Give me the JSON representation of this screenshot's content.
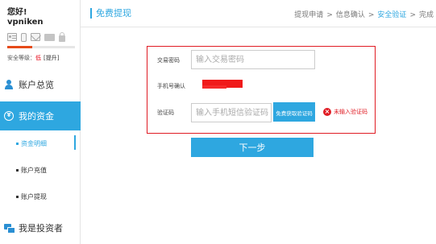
{
  "sidebar": {
    "greeting": "您好!",
    "username": "vpniken",
    "verify_icons": [
      "id-card-icon",
      "phone-icon",
      "mail-icon",
      "bank-card-icon",
      "lock-icon"
    ],
    "safety_label": "安全等级：",
    "safety_level": "低",
    "safety_upgrade": "[提升]",
    "safety_progress": 0.37,
    "nav": {
      "overview": "账户总览",
      "funds": "我的资金",
      "funds_icon_glyph": "¥",
      "investor": "我是投资者"
    },
    "sub": {
      "details": "资金明细",
      "recharge": "账户充值",
      "withdraw": "账户提现"
    }
  },
  "header": {
    "title": "免费提现",
    "steps": [
      "提现申请",
      "信息确认",
      "安全验证",
      "完成"
    ],
    "step_sep": ">",
    "active_step": 2
  },
  "form": {
    "pwd_label": "交易密码",
    "pwd_placeholder": "输入交易密码",
    "phone_label": "手机号确认",
    "code_label": "验证码",
    "code_placeholder": "输入手机短信验证码",
    "send_button": "免费获取验证码",
    "error_icon": "×",
    "error_text": "未输入验证码",
    "next_button": "下一步"
  },
  "colors": {
    "accent": "#2ea7e0",
    "error": "#e01c24",
    "redaction": "#f01a1a"
  }
}
